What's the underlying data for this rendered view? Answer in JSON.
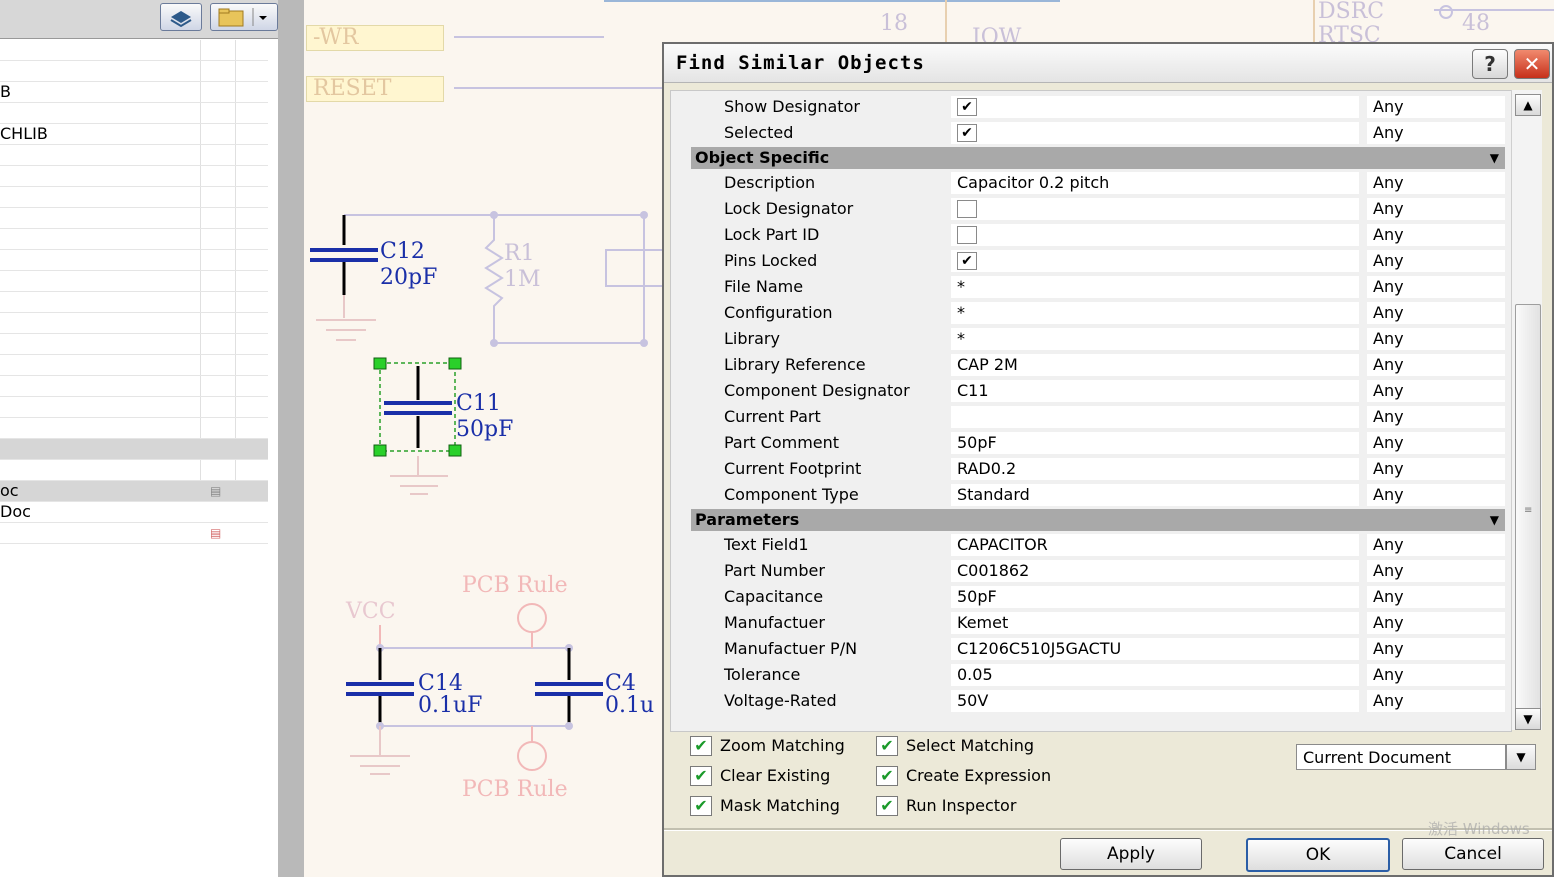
{
  "left_panel": {
    "rows": [
      {
        "label": ""
      },
      {
        "label": ""
      },
      {
        "label": "B"
      },
      {
        "label": ""
      },
      {
        "label": "CHLIB"
      },
      {
        "label": ""
      },
      {
        "label": ""
      },
      {
        "label": ""
      },
      {
        "label": ""
      },
      {
        "label": ""
      },
      {
        "label": ""
      },
      {
        "label": ""
      },
      {
        "label": ""
      },
      {
        "label": ""
      },
      {
        "label": ""
      },
      {
        "label": ""
      },
      {
        "label": ""
      },
      {
        "label": ""
      },
      {
        "label": ""
      },
      {
        "label": ""
      },
      {
        "label": ""
      },
      {
        "label": "oc"
      },
      {
        "label": "Doc"
      }
    ]
  },
  "schematic": {
    "port_wr": "-WR",
    "port_reset": "RESET",
    "top_num": "18",
    "top_iow": "IOW",
    "top_dsrc": "DSRC",
    "top_rtsc": "RTSC",
    "top_48": "48",
    "c12": "C12",
    "c12_val": "20pF",
    "r1": "R1",
    "r1_val": "1M",
    "c11": "C11",
    "c11_val": "50pF",
    "pcb_rule_1": "PCB Rule",
    "vcc": "VCC",
    "c14": "C14",
    "c14_val": "0.1uF",
    "c4": "C4",
    "c4_val": "0.1u",
    "pcb_rule_2": "PCB Rule"
  },
  "dialog": {
    "title": "Find Similar Objects",
    "help": "?",
    "close": "✕",
    "rows_top": [
      {
        "name": "Show Designator",
        "checked": true,
        "value": "",
        "match": "Any"
      },
      {
        "name": "Selected",
        "checked": true,
        "value": "",
        "match": "Any"
      }
    ],
    "section_object": "Object Specific",
    "rows_object": [
      {
        "name": "Description",
        "value": "Capacitor 0.2 pitch",
        "match": "Any"
      },
      {
        "name": "Lock Designator",
        "checkbox": true,
        "checked": false,
        "value": "",
        "match": "Any"
      },
      {
        "name": "Lock Part ID",
        "checkbox": true,
        "checked": false,
        "value": "",
        "match": "Any"
      },
      {
        "name": "Pins Locked",
        "checkbox": true,
        "checked": true,
        "value": "",
        "match": "Any"
      },
      {
        "name": "File Name",
        "value": "*",
        "match": "Any"
      },
      {
        "name": "Configuration",
        "value": "*",
        "match": "Any"
      },
      {
        "name": "Library",
        "value": "*",
        "match": "Any"
      },
      {
        "name": "Library Reference",
        "value": "CAP 2M",
        "match": "Any"
      },
      {
        "name": "Component Designator",
        "value": "C11",
        "match": "Any"
      },
      {
        "name": "Current Part",
        "value": "",
        "match": "Any"
      },
      {
        "name": "Part Comment",
        "value": "50pF",
        "match": "Any"
      },
      {
        "name": "Current Footprint",
        "value": "RAD0.2",
        "match": "Any"
      },
      {
        "name": "Component Type",
        "value": "Standard",
        "match": "Any"
      }
    ],
    "section_params": "Parameters",
    "rows_params": [
      {
        "name": "Text Field1",
        "value": "CAPACITOR",
        "match": "Any"
      },
      {
        "name": "Part Number",
        "value": "C001862",
        "match": "Any"
      },
      {
        "name": "Capacitance",
        "value": "50pF",
        "match": "Any"
      },
      {
        "name": "Manufactuer",
        "value": "Kemet",
        "match": "Any"
      },
      {
        "name": "Manufactuer P/N",
        "value": "C1206C510J5GACTU",
        "match": "Any"
      },
      {
        "name": "Tolerance",
        "value": "0.05",
        "match": "Any"
      },
      {
        "name": "Voltage-Rated",
        "value": "50V",
        "match": "Any"
      }
    ],
    "options": {
      "zoom": "Zoom Matching",
      "clear": "Clear Existing",
      "mask": "Mask Matching",
      "select": "Select Matching",
      "create": "Create Expression",
      "run": "Run Inspector"
    },
    "scope": "Current Document",
    "apply": "Apply",
    "ok": "OK",
    "cancel": "Cancel",
    "watermark": "激活 Windows"
  },
  "colors": {
    "accent": "#2b5ea6",
    "close": "#c6301a",
    "check_green": "#1a9a2a",
    "schematic_blue": "#1a2fa8"
  }
}
